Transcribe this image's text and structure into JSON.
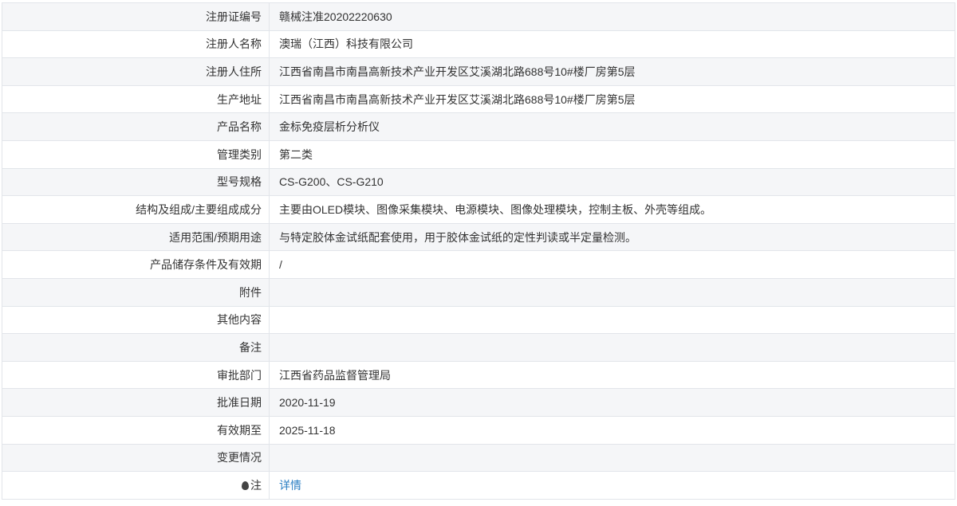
{
  "rows": [
    {
      "label": "注册证编号",
      "value": "赣械注准20202220630"
    },
    {
      "label": "注册人名称",
      "value": "澳瑞（江西）科技有限公司"
    },
    {
      "label": "注册人住所",
      "value": "江西省南昌市南昌高新技术产业开发区艾溪湖北路688号10#楼厂房第5层"
    },
    {
      "label": "生产地址",
      "value": "江西省南昌市南昌高新技术产业开发区艾溪湖北路688号10#楼厂房第5层"
    },
    {
      "label": "产品名称",
      "value": "金标免疫层析分析仪"
    },
    {
      "label": "管理类别",
      "value": "第二类"
    },
    {
      "label": "型号规格",
      "value": "CS-G200、CS-G210"
    },
    {
      "label": "结构及组成/主要组成成分",
      "value": "主要由OLED模块、图像采集模块、电源模块、图像处理模块，控制主板、外壳等组成。"
    },
    {
      "label": "适用范围/预期用途",
      "value": "与特定胶体金试纸配套使用，用于胶体金试纸的定性判读或半定量检测。"
    },
    {
      "label": "产品储存条件及有效期",
      "value": "/"
    },
    {
      "label": "附件",
      "value": ""
    },
    {
      "label": "其他内容",
      "value": ""
    },
    {
      "label": "备注",
      "value": ""
    },
    {
      "label": "审批部门",
      "value": "江西省药品监督管理局"
    },
    {
      "label": "批准日期",
      "value": "2020-11-19"
    },
    {
      "label": "有效期至",
      "value": "2025-11-18"
    },
    {
      "label": "变更情况",
      "value": ""
    }
  ],
  "note_row": {
    "label": "注",
    "icon": "note-icon",
    "link_text": "详情",
    "link_color": "#2b7fc3"
  }
}
